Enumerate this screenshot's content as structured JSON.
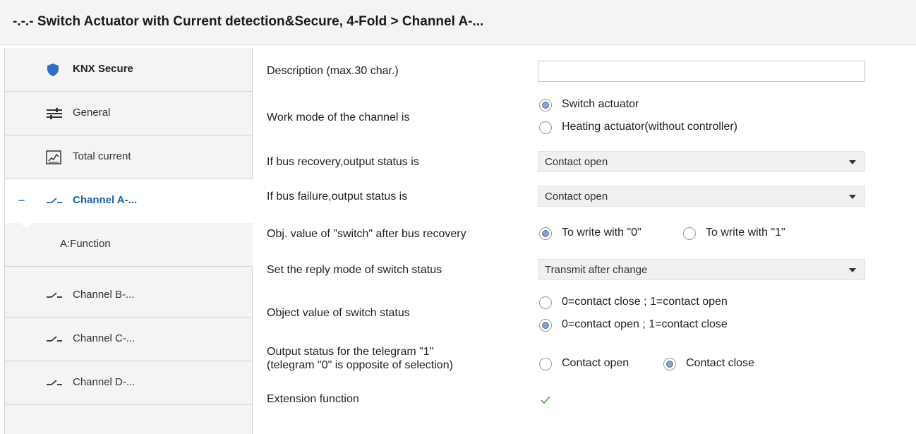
{
  "window": {
    "title": "-.-.- Switch Actuator with Current detection&Secure, 4-Fold > Channel A-..."
  },
  "sidebar": {
    "items": [
      {
        "label": "KNX Secure",
        "icon": "shield-icon"
      },
      {
        "label": "General",
        "icon": "sliders-icon"
      },
      {
        "label": "Total current",
        "icon": "chart-icon"
      },
      {
        "label": "Channel A-...",
        "icon": "switch-icon",
        "expanded": true
      },
      {
        "label": "A:Function"
      },
      {
        "label": "Channel B-...",
        "icon": "switch-icon"
      },
      {
        "label": "Channel C-...",
        "icon": "switch-icon"
      },
      {
        "label": "Channel D-...",
        "icon": "switch-icon"
      }
    ],
    "collapse_symbol": "−"
  },
  "form": {
    "description": {
      "label": "Description (max.30 char.)",
      "value": ""
    },
    "work_mode": {
      "label": "Work mode of the channel is",
      "options": [
        "Switch actuator",
        "Heating actuator(without controller)"
      ],
      "selected": "Switch actuator"
    },
    "bus_recovery": {
      "label": "If bus recovery,output status is",
      "value": "Contact open"
    },
    "bus_failure": {
      "label": "If bus failure,output status is",
      "value": "Contact open"
    },
    "obj_switch": {
      "label": "Obj. value of \"switch\" after bus recovery",
      "options": [
        "To write with \"0\"",
        "To write with \"1\""
      ],
      "selected": "To write with \"0\""
    },
    "reply_mode": {
      "label": "Set the reply mode of switch status",
      "value": "Transmit after change"
    },
    "obj_status": {
      "label": "Object value of switch status",
      "options": [
        "0=contact close ; 1=contact open",
        "0=contact open ; 1=contact close"
      ],
      "selected": "0=contact open ; 1=contact close"
    },
    "output_status": {
      "label_line1": "Output status for the telegram \"1\"",
      "label_line2": " (telegram \"0\" is opposite of selection)",
      "options": [
        "Contact open",
        "Contact close"
      ],
      "selected": "Contact close"
    },
    "extension": {
      "label": "Extension function",
      "checked": true
    }
  },
  "colors": {
    "accent": "#1f5fa8",
    "shield": "#2e6fc0",
    "check": "#5cb85c"
  }
}
